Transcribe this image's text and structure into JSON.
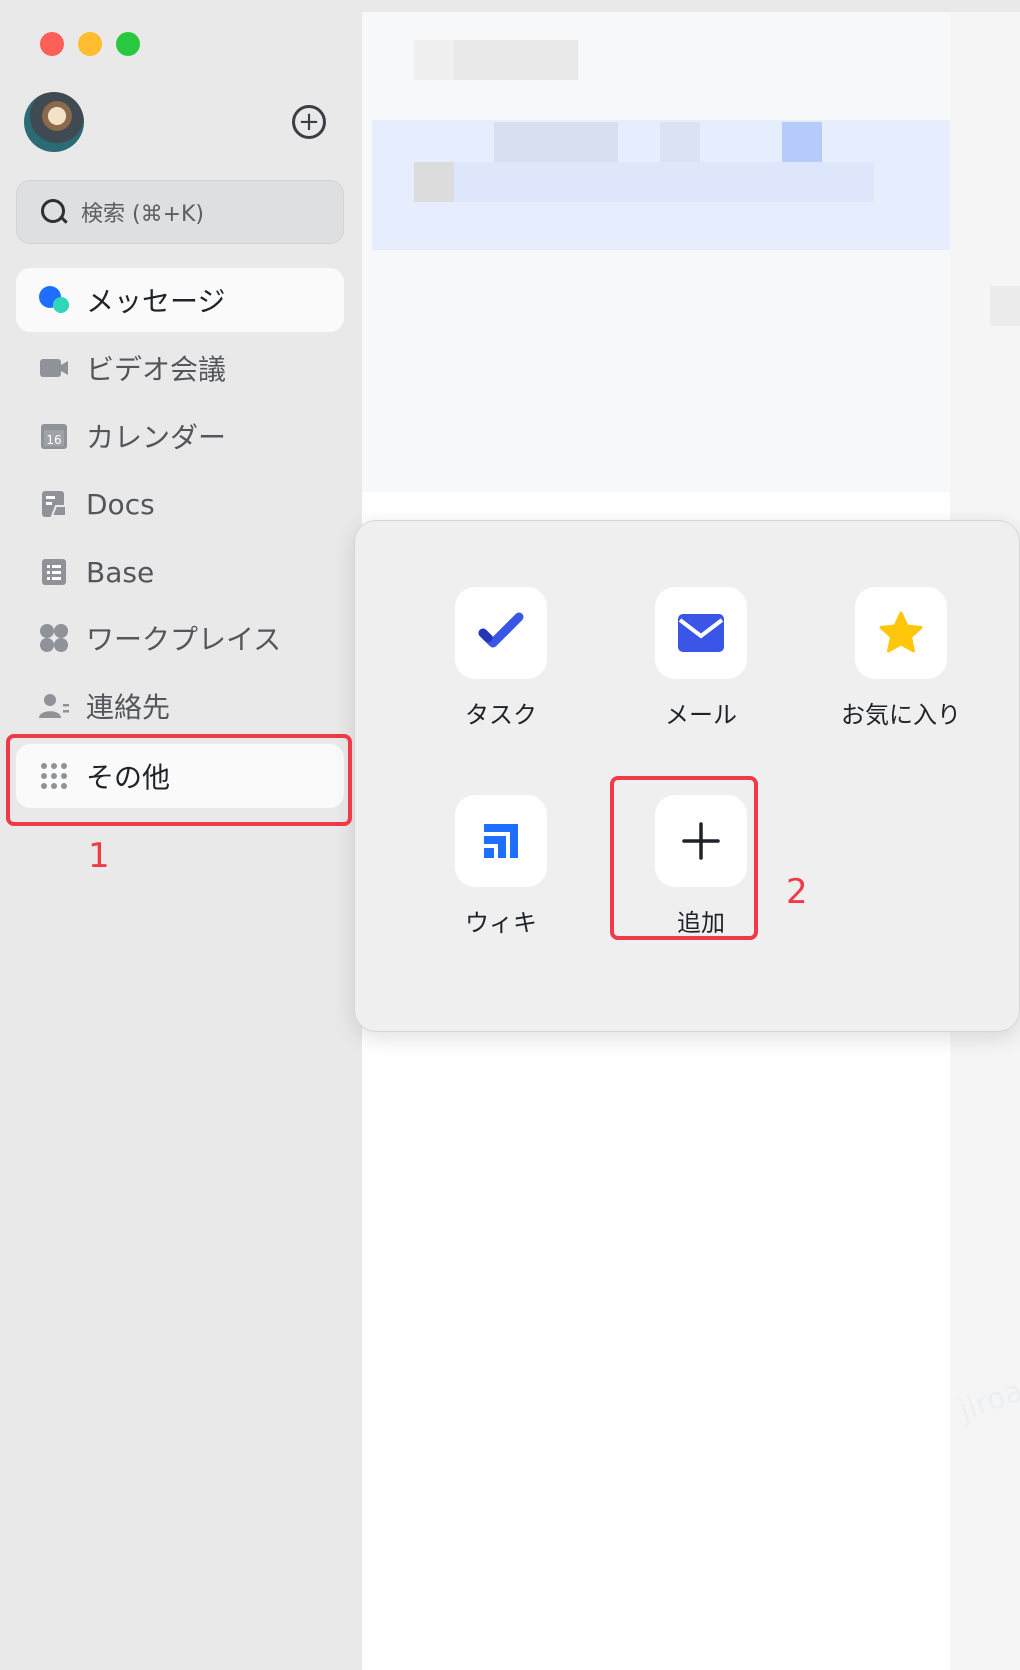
{
  "sidebar": {
    "window_controls": [
      {
        "name": "close",
        "color": "#fe5f57"
      },
      {
        "name": "minimize",
        "color": "#febc2e"
      },
      {
        "name": "maximize",
        "color": "#28c840"
      }
    ],
    "add_icon": "plus-circle-icon",
    "search": {
      "placeholder": "検索 (⌘+K)"
    },
    "items": [
      {
        "label": "メッセージ",
        "icon": "chat-bubble-icon",
        "active": true
      },
      {
        "label": "ビデオ会議",
        "icon": "video-camera-icon"
      },
      {
        "label": "カレンダー",
        "icon": "calendar-icon",
        "icon_text": "16"
      },
      {
        "label": "Docs",
        "icon": "docs-icon"
      },
      {
        "label": "Base",
        "icon": "base-icon"
      },
      {
        "label": "ワークプレイス",
        "icon": "workplace-icon"
      },
      {
        "label": "連絡先",
        "icon": "contacts-icon"
      },
      {
        "label": "その他",
        "icon": "more-grid-icon"
      }
    ]
  },
  "popover": {
    "apps": [
      {
        "label": "タスク",
        "icon": "task-check-icon",
        "color": "#3b55e6"
      },
      {
        "label": "メール",
        "icon": "mail-icon",
        "color": "#3b55e6"
      },
      {
        "label": "お気に入り",
        "icon": "star-icon",
        "color": "#ffc60a"
      },
      {
        "label": "ウィキ",
        "icon": "wiki-icon",
        "color": "#1e6fff"
      },
      {
        "label": "追加",
        "icon": "plus-icon",
        "color": "#1f2329"
      }
    ]
  },
  "annotations": {
    "step1": "1",
    "step2": "2",
    "highlight_color": "#f03a47"
  },
  "watermark": "jiroab"
}
